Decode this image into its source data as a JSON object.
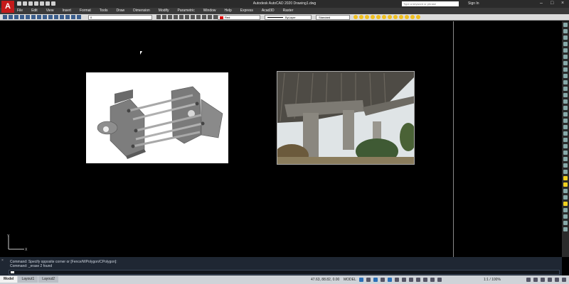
{
  "app": {
    "logo_letter": "A",
    "title": "Autodesk AutoCAD 2020  Drawing1.dwg",
    "search_placeholder": "Type a keyword or phrase",
    "sign_in": "Sign In"
  },
  "menu": [
    "File",
    "Edit",
    "View",
    "Insert",
    "Format",
    "Tools",
    "Draw",
    "Dimension",
    "Modify",
    "Parametric",
    "Window",
    "Help",
    "Express",
    "Acad3D",
    "Raster"
  ],
  "toolbar": {
    "layer": "0",
    "color": "Red",
    "linetype": "ByLayer",
    "text_style": "Standard"
  },
  "drawing": {
    "image1_name": "steel-connection-3d-model",
    "image2_name": "bridge-underside-photo",
    "ucs_y": "Y",
    "ucs_x": "X"
  },
  "command": {
    "line1": "Command: Specify opposite corner or [Fence/WPolygon/CPolygon]:",
    "line2": "Command: _erase 2 found"
  },
  "status": {
    "tabs": [
      "Model",
      "Layout1",
      "Layout2"
    ],
    "coords": "47.63, 88.82, 0.00",
    "model": "MODEL",
    "annotation_scale": "1:1 / 100%"
  }
}
